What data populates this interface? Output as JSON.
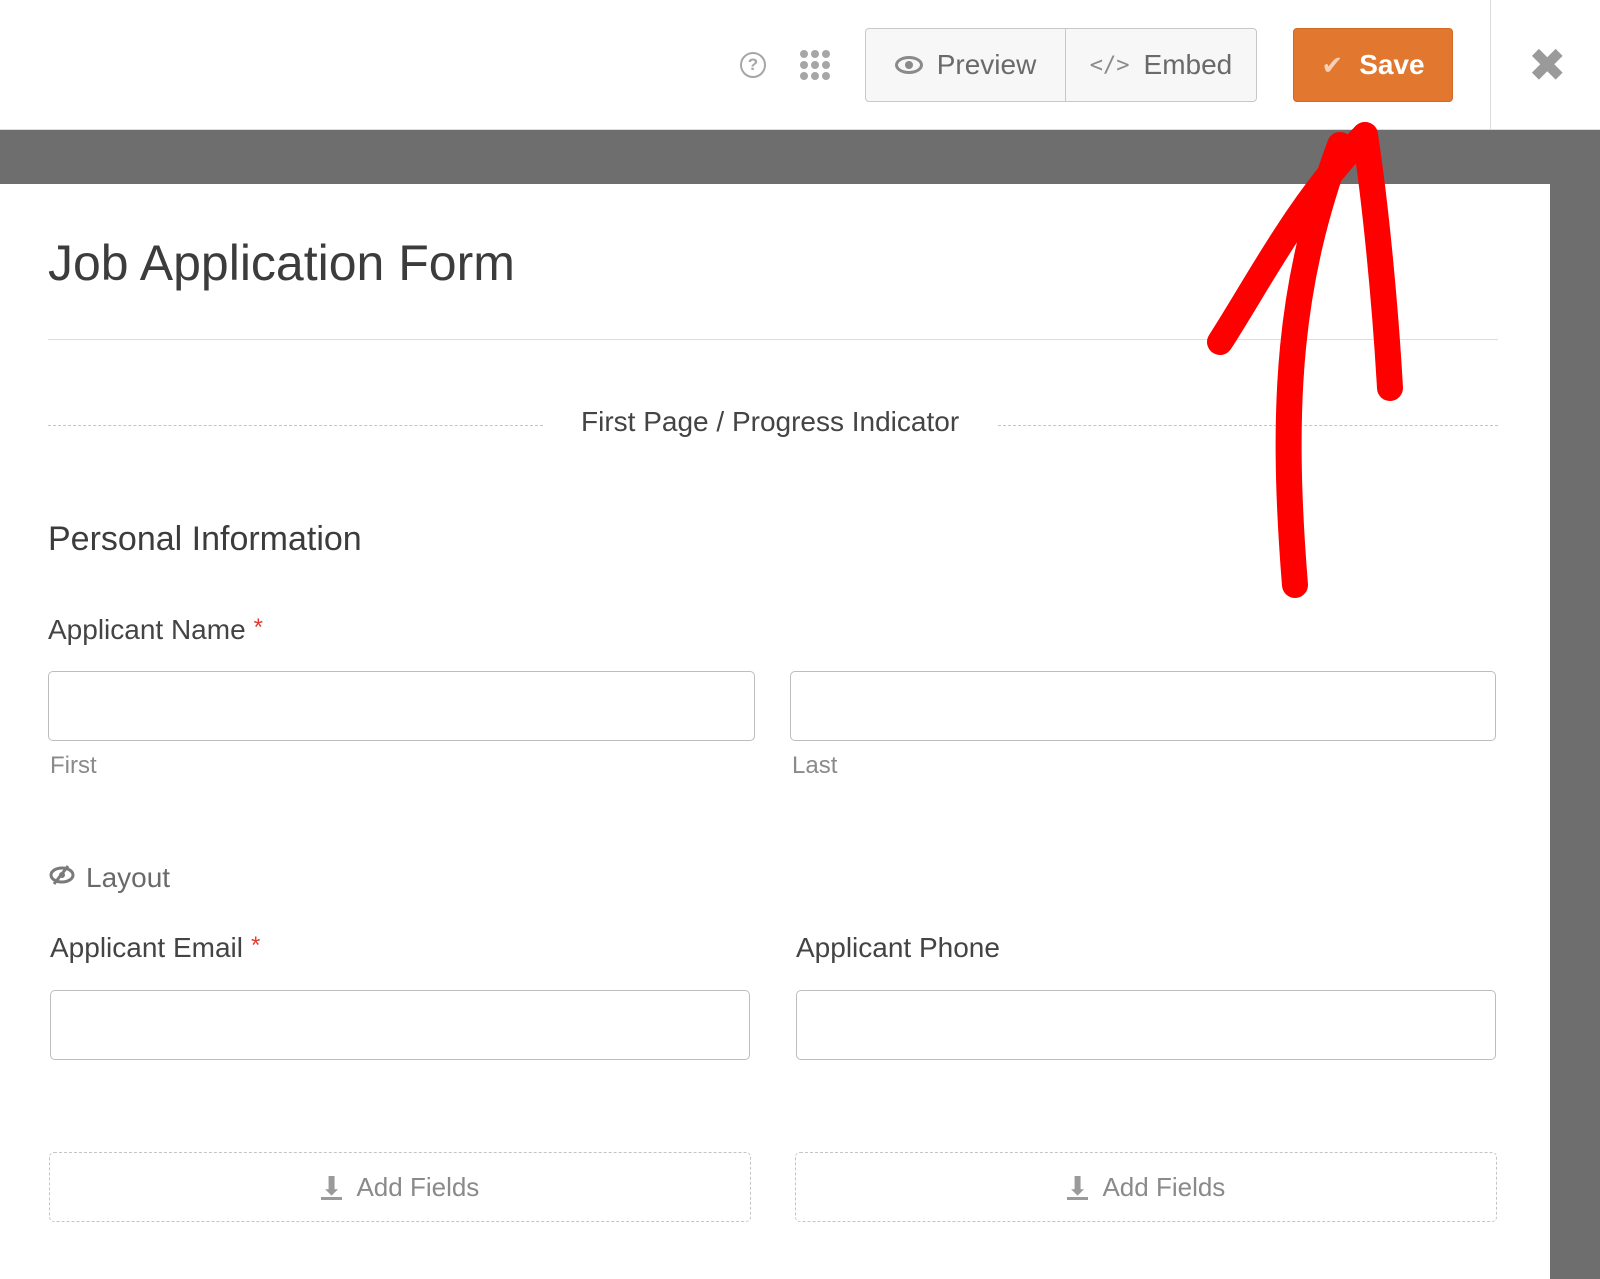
{
  "toolbar": {
    "help_icon": "question-circle-icon",
    "apps_icon": "grid-dots-icon",
    "preview_label": "Preview",
    "preview_icon": "eye-icon",
    "embed_label": "Embed",
    "embed_icon": "code-icon",
    "embed_icon_glyph": "</>",
    "save_label": "Save",
    "save_icon": "check-icon",
    "save_icon_glyph": "✔",
    "close_icon": "close-icon",
    "close_icon_glyph": "✖",
    "accent_color": "#e27730"
  },
  "form": {
    "title": "Job Application Form",
    "page_break_label": "First Page / Progress Indicator",
    "section_title": "Personal Information",
    "fields": [
      {
        "label": "Applicant Name",
        "required": true,
        "required_mark": "*",
        "subfields": [
          {
            "sublabel": "First",
            "value": ""
          },
          {
            "sublabel": "Last",
            "value": ""
          }
        ]
      },
      {
        "label": "Applicant Email",
        "required": true,
        "required_mark": "*",
        "value": ""
      },
      {
        "label": "Applicant Phone",
        "required": false,
        "value": ""
      }
    ],
    "layout_label": "Layout",
    "layout_icon": "eye-slash-icon",
    "layout_icon_glyph": "👁",
    "add_fields_label": "Add Fields",
    "add_fields_icon": "download-arrow-icon",
    "add_fields_icon_glyph": "⬇"
  },
  "annotation": {
    "type": "red-arrow",
    "points_to": "save-button",
    "color": "#ff0000"
  }
}
